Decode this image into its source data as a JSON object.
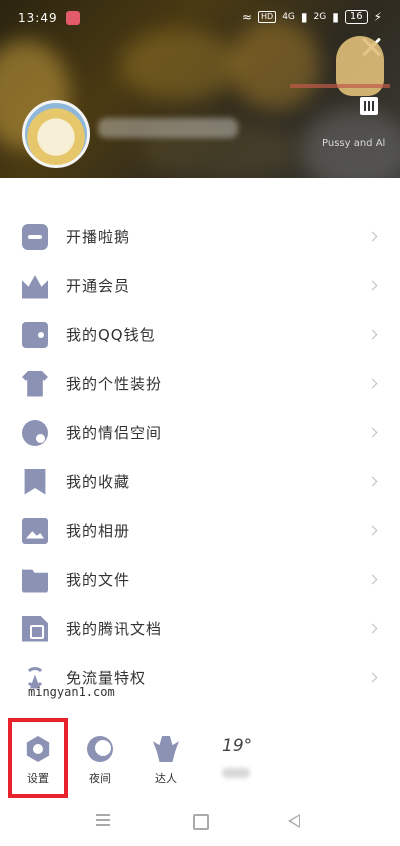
{
  "status_bar": {
    "time": "13:49",
    "hd_label": "HD",
    "signal_1": "4G",
    "signal_2": "2G",
    "battery": "16"
  },
  "profile": {
    "signature": "Pussy and Al"
  },
  "menu": {
    "items": [
      {
        "label": "开播啦鹅",
        "icon": "tv-icon"
      },
      {
        "label": "开通会员",
        "icon": "crown-icon"
      },
      {
        "label": "我的QQ钱包",
        "icon": "wallet-icon"
      },
      {
        "label": "我的个性装扮",
        "icon": "shirt-icon"
      },
      {
        "label": "我的情侣空间",
        "icon": "heart-icon"
      },
      {
        "label": "我的收藏",
        "icon": "bookmark-icon"
      },
      {
        "label": "我的相册",
        "icon": "photo-icon"
      },
      {
        "label": "我的文件",
        "icon": "folder-icon"
      },
      {
        "label": "我的腾讯文档",
        "icon": "document-icon"
      },
      {
        "label": "免流量特权",
        "icon": "radio-tower-icon"
      }
    ]
  },
  "watermark": "mingyan1.com",
  "bottom_bar": {
    "settings_label": "设置",
    "night_label": "夜间",
    "expert_label": "达人",
    "weather_temp": "19°"
  },
  "colors": {
    "icon": "#8c92b3",
    "highlight": "#e8232d"
  }
}
